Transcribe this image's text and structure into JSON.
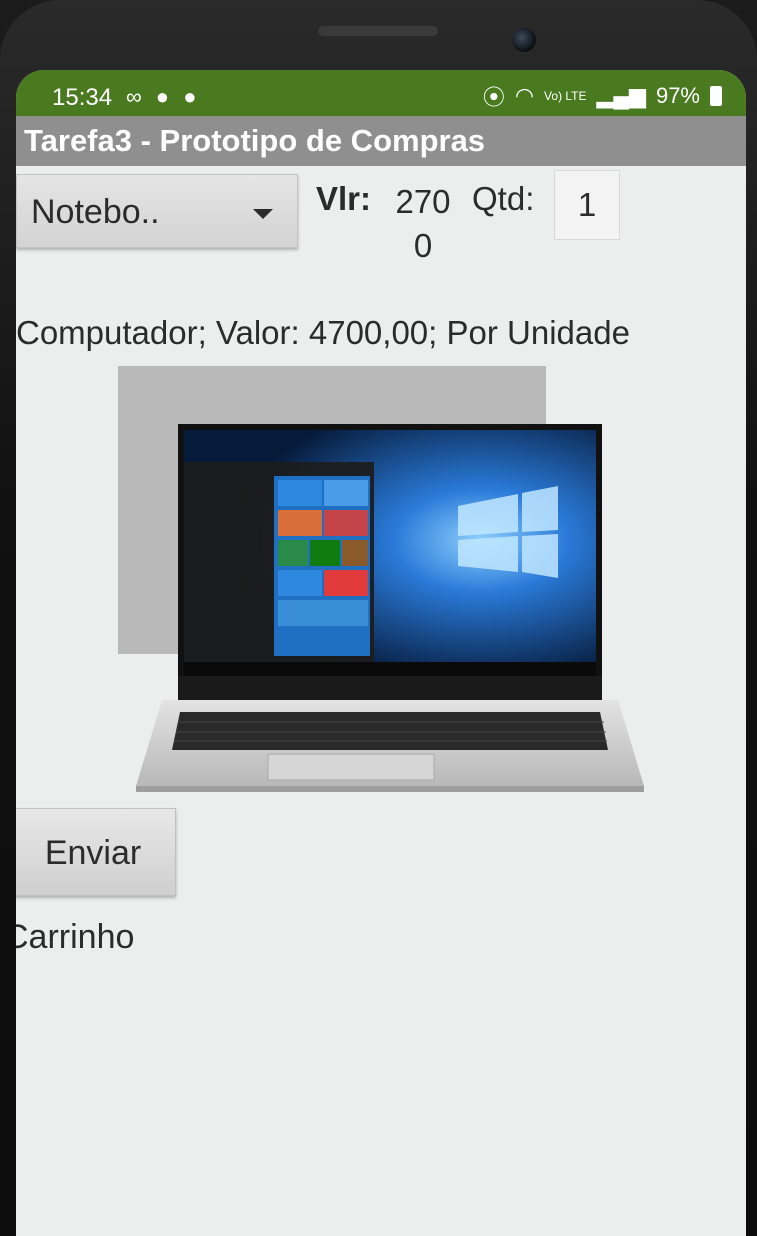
{
  "status_bar": {
    "time": "15:34",
    "left_icons": "∞ ● ●",
    "battery_percent": "97%",
    "network_label": "Vo) LTE"
  },
  "app": {
    "title": "Tarefa3 - Prototipo de Compras"
  },
  "form": {
    "product_select": "Notebo..",
    "price_label": "Vlr:",
    "price_value": "2700",
    "quantity_label": "Qtd:",
    "quantity_value": "1"
  },
  "product": {
    "description": "Computador; Valor: 4700,00; Por Unidade",
    "image_icon": "laptop-image"
  },
  "actions": {
    "send_label": "Enviar"
  },
  "cart": {
    "label": "Carrinho"
  },
  "colors": {
    "status_bar": "#4a7a1f",
    "title_bar": "#8f8f8f",
    "background": "#eceeed"
  }
}
